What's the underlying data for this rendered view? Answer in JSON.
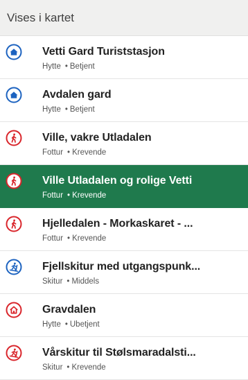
{
  "header": {
    "title": "Vises i kartet"
  },
  "colors": {
    "cabin_blue": "#1d63c0",
    "route_red": "#d9252b",
    "selected_bg": "#1f7a4d"
  },
  "items": [
    {
      "title": "Vetti Gard Turiststasjon",
      "category": "Hytte",
      "detail": "Betjent",
      "icon": "cabin-icon",
      "selected": false
    },
    {
      "title": "Avdalen gard",
      "category": "Hytte",
      "detail": "Betjent",
      "icon": "cabin-icon",
      "selected": false
    },
    {
      "title": "Ville, vakre Utladalen",
      "category": "Fottur",
      "detail": "Krevende",
      "icon": "hiker-icon",
      "selected": false
    },
    {
      "title": "Ville Utladalen og rolige Vetti",
      "category": "Fottur",
      "detail": "Krevende",
      "icon": "hiker-icon",
      "selected": true
    },
    {
      "title": "Hjelledalen - Morkaskaret - ...",
      "category": "Fottur",
      "detail": "Krevende",
      "icon": "hiker-icon",
      "selected": false
    },
    {
      "title": "Fjellskitur med utgangspunk...",
      "category": "Skitur",
      "detail": "Middels",
      "icon": "skier-icon",
      "selected": false
    },
    {
      "title": "Gravdalen",
      "category": "Hytte",
      "detail": "Ubetjent",
      "icon": "unstaffed-cabin-icon",
      "selected": false
    },
    {
      "title": "Vårskitur til Stølsmaradalsti...",
      "category": "Skitur",
      "detail": "Krevende",
      "icon": "skier-icon",
      "selected": false
    }
  ]
}
